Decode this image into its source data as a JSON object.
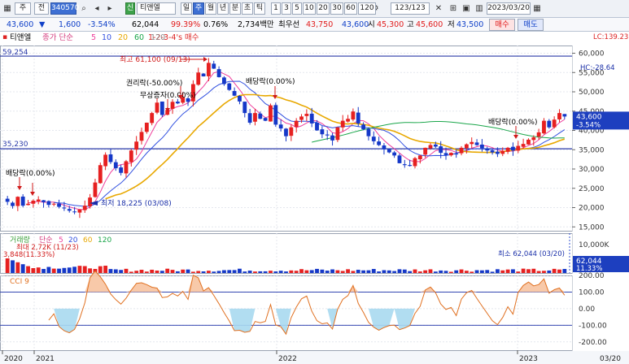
{
  "toolbar": {
    "menu_label": "주",
    "menu2_label": "전",
    "code": "340570",
    "name_badge": "신",
    "name": "티앤엘",
    "periods": [
      "일",
      "주",
      "월",
      "년",
      "분",
      "초",
      "틱"
    ],
    "selected_period": "주",
    "intervals": [
      "1",
      "3",
      "5",
      "10",
      "20",
      "30",
      "60",
      "120"
    ],
    "counter": "123/123",
    "date": "2023/03/20"
  },
  "quote": {
    "price": "43,600",
    "change": "1,600",
    "change_pct": "-3.54%",
    "volume": "62,044",
    "vol_ratio": "99.39%",
    "turnover_pct": "0.76%",
    "amount": "2,734백만",
    "best_bid_label": "최우선",
    "best_bid": "43,750",
    "best_ask": "43,600",
    "open_label": "시",
    "open": "45,300",
    "high_label": "고",
    "high": "45,600",
    "low_label": "저",
    "low": "43,500",
    "buy_label": "매수",
    "sell_label": "매도"
  },
  "legend": {
    "name": "티앤엘",
    "ma_label": "종가 단순",
    "ma_periods": [
      "5",
      "10",
      "20",
      "60",
      "120"
    ],
    "ma_colors": [
      "#ee3f9c",
      "#3150e0",
      "#e8a800",
      "#1aa64a",
      "#8a8a8a"
    ],
    "pattern": "1-2-3-4's 매수",
    "lc": "LC:139.23",
    "hc": "HC:-28.64"
  },
  "price_panel": {
    "high_line": "59,254",
    "low_line": "35,230",
    "annotations": {
      "max": "최고 61,100 (09/13)",
      "min": "최저 18,225 (03/08)",
      "rights": "권리락(-50.00%)",
      "bonus": "무상증자(0.00%)",
      "div1": "배당락(0.00%)",
      "div2": "배당락(0.00%)",
      "div3": "배당락(0.00%)"
    },
    "last_price": "43,600",
    "last_pct": "-3.54%",
    "y_ticks": [
      "60,000",
      "55,000",
      "50,000",
      "45,000",
      "40,000",
      "35,000",
      "30,000",
      "25,000",
      "20,000",
      "15,000"
    ]
  },
  "volume_panel": {
    "label": "거래량",
    "ma_label": "단순",
    "ma_periods": [
      "5",
      "20",
      "60",
      "120"
    ],
    "max_note": "최대 2,72K (11/23)",
    "sub_note": "3,848(11.33%)",
    "min_note": "최소 62,044 (03/20)",
    "y_tick": "10,000K",
    "last_value": "62,044",
    "last_pct": "11.33%"
  },
  "cci_panel": {
    "label": "CCI 9",
    "y_ticks": [
      "200.00",
      "100.00",
      "0.00",
      "-100.00",
      "-200.00"
    ]
  },
  "x_axis": {
    "labels": [
      "2020",
      "2021",
      "2022",
      "2023",
      "03/20"
    ]
  },
  "chart_data": {
    "type": "candlestick",
    "series_close_weekly": [
      21500,
      20400,
      22800,
      20500,
      21000,
      21800,
      22100,
      21400,
      20700,
      21000,
      20200,
      19800,
      19200,
      18800,
      19500,
      20500,
      22600,
      26500,
      31000,
      33700,
      31800,
      30200,
      29000,
      32000,
      34800,
      37100,
      39600,
      42000,
      44500,
      47200,
      44000,
      45300,
      47400,
      47000,
      48600,
      47400,
      52000,
      55000,
      54000,
      57500,
      56000,
      53800,
      52000,
      50500,
      49000,
      47500,
      44500,
      42000,
      44500,
      43000,
      42500,
      46500,
      41500,
      40500,
      38500,
      40800,
      42500,
      43600,
      44300,
      41800,
      40000,
      39000,
      38700,
      37400,
      40800,
      42500,
      43000,
      44900,
      41800,
      40300,
      38500,
      37200,
      36200,
      35100,
      34300,
      33500,
      31500,
      31000,
      30800,
      32800,
      33500,
      35500,
      36200,
      35800,
      34200,
      33600,
      34200,
      33800,
      35500,
      36400,
      37000,
      36200,
      35400,
      34800,
      34300,
      33900,
      34700,
      35500,
      34800,
      36000,
      36500,
      37600,
      38200,
      39500,
      42500,
      40800,
      42800,
      44500,
      43600
    ],
    "ylim": [
      14000,
      62000
    ],
    "max": {
      "value": 61100,
      "date": "09/13"
    },
    "min": {
      "value": 18225,
      "date": "03/08"
    }
  }
}
